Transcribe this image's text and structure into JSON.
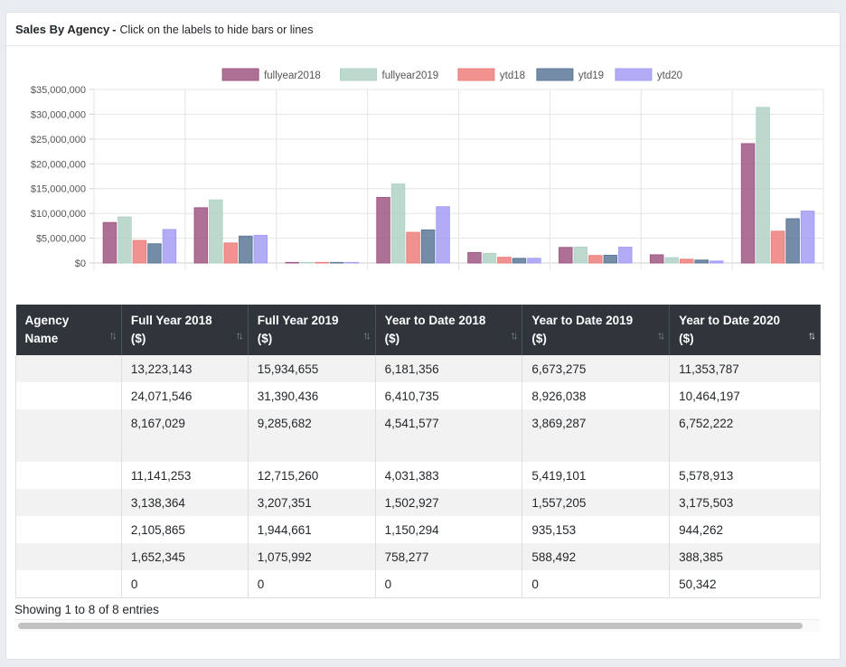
{
  "header": {
    "title": "Sales By Agency",
    "separator": "-",
    "subtitle": "Click on the labels to hide bars or lines"
  },
  "chart_data": {
    "type": "bar",
    "title": "",
    "xlabel": "",
    "ylabel": "",
    "ylim": [
      0,
      35000000
    ],
    "yticks": [
      "$35,000,000",
      "$30,000,000",
      "$25,000,000",
      "$20,000,000",
      "$15,000,000",
      "$10,000,000",
      "$5,000,000",
      "$0"
    ],
    "grid": true,
    "legend_position": "top",
    "categories": [
      "",
      "",
      "",
      "",
      "",
      "",
      "",
      ""
    ],
    "series": [
      {
        "name": "fullyear2018",
        "color": "#a05884",
        "values": [
          8167029,
          11141253,
          0,
          13223143,
          2105865,
          3138364,
          1652345,
          24071546
        ]
      },
      {
        "name": "fullyear2019",
        "color": "#b1d2c6",
        "values": [
          9285682,
          12715260,
          0,
          15934655,
          1944661,
          3207351,
          1075992,
          31390436
        ]
      },
      {
        "name": "ytd18",
        "color": "#ec7f7c",
        "values": [
          4541577,
          4031383,
          0,
          6181356,
          1150294,
          1502927,
          758277,
          6410735
        ]
      },
      {
        "name": "ytd19",
        "color": "#5c7897",
        "values": [
          3869287,
          5419101,
          0,
          6673275,
          935153,
          1557205,
          588492,
          8926038
        ]
      },
      {
        "name": "ytd20",
        "color": "#a49df4",
        "values": [
          6752222,
          5578913,
          50342,
          11353787,
          944262,
          3175503,
          388385,
          10464197
        ]
      }
    ]
  },
  "table": {
    "columns": [
      {
        "line1": "Agency",
        "line2": "Name",
        "sort": "↑↓",
        "active": false
      },
      {
        "line1": "Full Year 2018",
        "line2": "($)",
        "sort": "↑↓",
        "active": false
      },
      {
        "line1": "Full Year 2019",
        "line2": "($)",
        "sort": "↑↓",
        "active": false
      },
      {
        "line1": "Year to Date 2018",
        "line2": "($)",
        "sort": "↑↓",
        "active": false
      },
      {
        "line1": "Year to Date 2019",
        "line2": "($)",
        "sort": "↑↓",
        "active": false
      },
      {
        "line1": "Year to Date 2020",
        "line2": "($)",
        "sort": "↑↓",
        "active": true
      }
    ],
    "rows": [
      [
        "",
        "13,223,143",
        "15,934,655",
        "6,181,356",
        "6,673,275",
        "11,353,787"
      ],
      [
        "",
        "24,071,546",
        "31,390,436",
        "6,410,735",
        "8,926,038",
        "10,464,197"
      ],
      [
        "",
        "8,167,029",
        "9,285,682",
        "4,541,577",
        "3,869,287",
        "6,752,222"
      ],
      [
        "",
        "11,141,253",
        "12,715,260",
        "4,031,383",
        "5,419,101",
        "5,578,913"
      ],
      [
        "",
        "3,138,364",
        "3,207,351",
        "1,502,927",
        "1,557,205",
        "3,175,503"
      ],
      [
        "",
        "2,105,865",
        "1,944,661",
        "1,150,294",
        "935,153",
        "944,262"
      ],
      [
        "",
        "1,652,345",
        "1,075,992",
        "758,277",
        "588,492",
        "388,385"
      ],
      [
        "",
        "0",
        "0",
        "0",
        "0",
        "50,342"
      ]
    ]
  },
  "info": "Showing 1 to 8 of 8 entries"
}
